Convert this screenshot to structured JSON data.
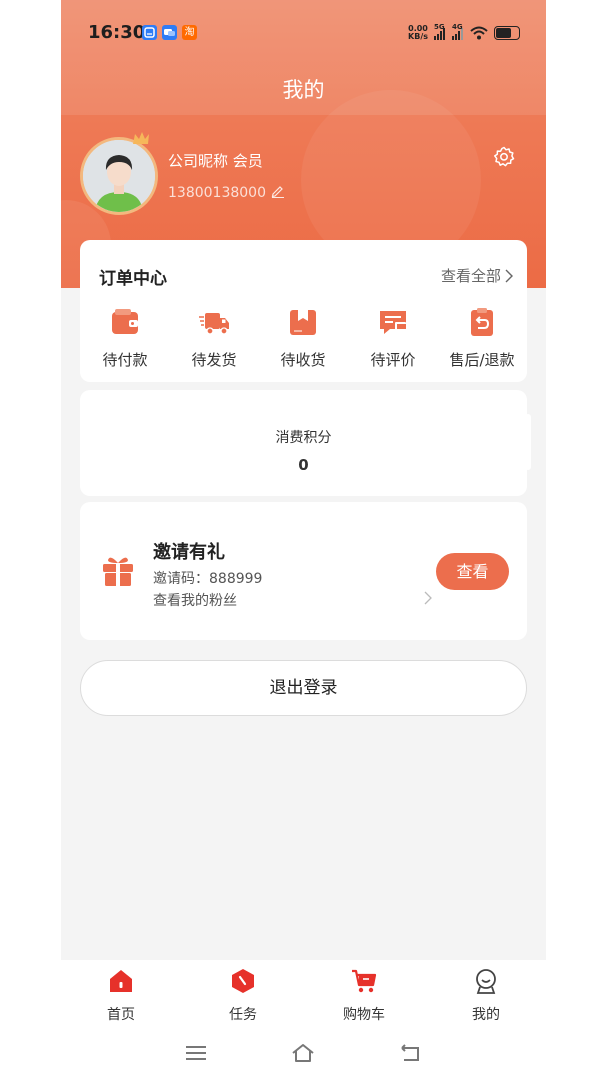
{
  "status_bar": {
    "time": "16:30",
    "net_speed_value": "0.00",
    "net_speed_unit": "KB/s",
    "signal_1": "5G",
    "signal_2": "4G",
    "app_icons": [
      "mail-app-icon",
      "chat-app-icon",
      "taobao-app-icon"
    ],
    "app_icon_colors": [
      "#2f7cf6",
      "#2f7cf6",
      "#ff6a00"
    ],
    "taobao_glyph": "淘"
  },
  "header": {
    "title": "我的",
    "nickname": "公司昵称 会员",
    "phone": "13800138000"
  },
  "order_center": {
    "title": "订单中心",
    "view_all": "查看全部",
    "items": [
      {
        "label": "待付款",
        "icon": "wallet-icon"
      },
      {
        "label": "待发货",
        "icon": "delivery-truck-icon"
      },
      {
        "label": "待收货",
        "icon": "package-box-icon"
      },
      {
        "label": "待评价",
        "icon": "review-message-icon"
      },
      {
        "label": "售后/退款",
        "icon": "refund-clipboard-icon"
      }
    ]
  },
  "points": {
    "label": "消费积分",
    "value": "0"
  },
  "invite": {
    "title": "邀请有礼",
    "code_text": "邀请码：888999",
    "fans_text": "查看我的粉丝",
    "button": "查看"
  },
  "logout": {
    "label": "退出登录"
  },
  "tabbar": {
    "items": [
      {
        "label": "首页",
        "icon": "home-icon"
      },
      {
        "label": "任务",
        "icon": "task-icon"
      },
      {
        "label": "购物车",
        "icon": "cart-icon"
      },
      {
        "label": "我的",
        "icon": "profile-icon"
      }
    ],
    "active_index": 3
  },
  "colors": {
    "accent": "#ec6e4d",
    "header_top": "#ef8a6a",
    "header_bottom": "#ec6b45",
    "tab_icon_red": "#e6312a"
  }
}
